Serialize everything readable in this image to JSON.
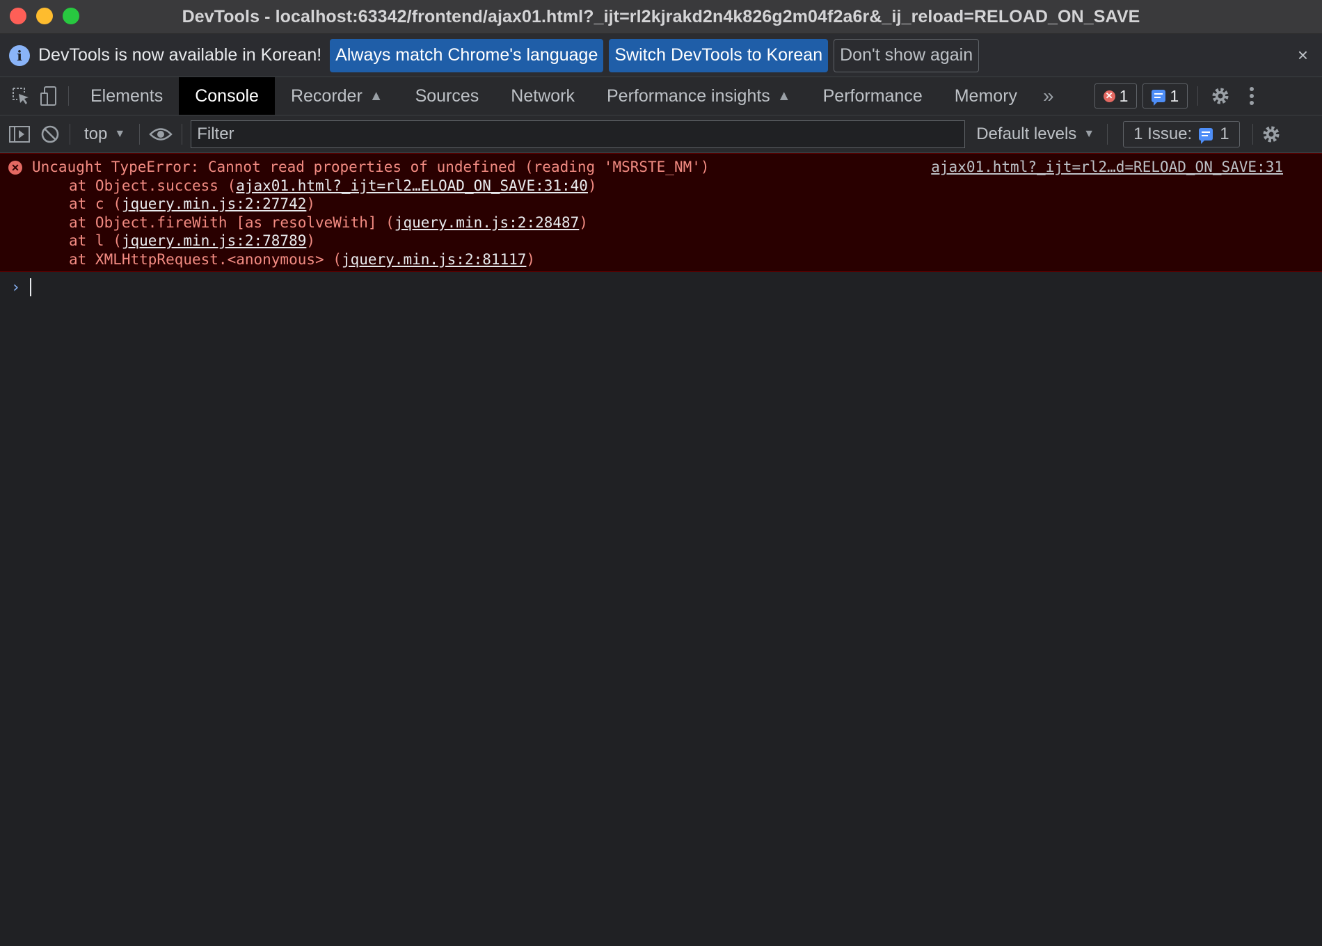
{
  "window": {
    "title": "DevTools - localhost:63342/frontend/ajax01.html?_ijt=rl2kjrakd2n4k826g2m04f2a6r&_ij_reload=RELOAD_ON_SAVE"
  },
  "infobar": {
    "message": "DevTools is now available in Korean!",
    "buttons": {
      "match_language": "Always match Chrome's language",
      "switch_korean": "Switch DevTools to Korean",
      "dont_show": "Don't show again"
    },
    "close_icon": "×"
  },
  "tabs": {
    "elements": "Elements",
    "console": "Console",
    "recorder": "Recorder",
    "sources": "Sources",
    "network": "Network",
    "performance_insights": "Performance insights",
    "performance": "Performance",
    "memory": "Memory",
    "more": "»",
    "active": "Console"
  },
  "counters": {
    "errors": "1",
    "messages": "1"
  },
  "console_toolbar": {
    "context": "top",
    "filter_placeholder": "Filter",
    "levels": "Default levels",
    "issues_label": "1 Issue:",
    "issues_count": "1"
  },
  "messages": {
    "error": {
      "text": "Uncaught TypeError: Cannot read properties of undefined (reading 'MSRSTE_NM')",
      "source": "ajax01.html?_ijt=rl2…d=RELOAD_ON_SAVE:31",
      "stack": [
        {
          "prefix": "at Object.success (",
          "link": "ajax01.html?_ijt=rl2…ELOAD_ON_SAVE:31:40",
          "suffix": ")"
        },
        {
          "prefix": "at c (",
          "link": "jquery.min.js:2:27742",
          "suffix": ")"
        },
        {
          "prefix": "at Object.fireWith [as resolveWith] (",
          "link": "jquery.min.js:2:28487",
          "suffix": ")"
        },
        {
          "prefix": "at l (",
          "link": "jquery.min.js:2:78789",
          "suffix": ")"
        },
        {
          "prefix": "at XMLHttpRequest.<anonymous> (",
          "link": "jquery.min.js:2:81117",
          "suffix": ")"
        }
      ]
    }
  },
  "prompt": {
    "caret": "›"
  },
  "colors": {
    "background": "#202124",
    "error_background": "#290000",
    "error_text": "#f28b82",
    "accent_blue": "#1f5ea8"
  },
  "icons": [
    "inspect-element-icon",
    "device-toolbar-icon",
    "flask-icon",
    "settings-gear-icon",
    "kebab-menu-icon",
    "sidebar-toggle-icon",
    "clear-console-icon",
    "eye-icon",
    "error-icon",
    "message-icon"
  ]
}
